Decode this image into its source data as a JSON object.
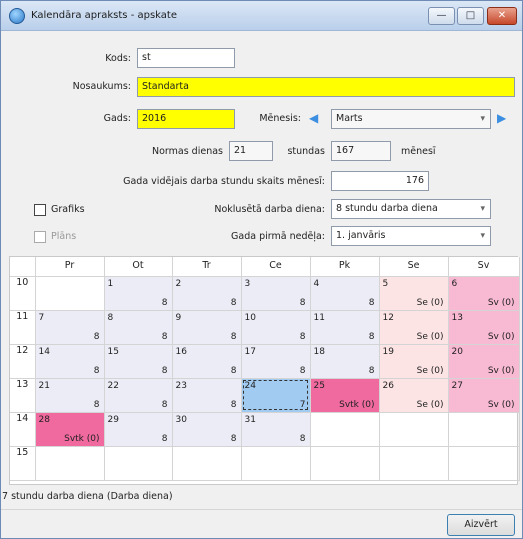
{
  "window": {
    "title": "Kalendāra apraksts - apskate",
    "btn_min": "—",
    "btn_max": "□",
    "btn_close": "✕"
  },
  "form": {
    "kods_label": "Kods:",
    "kods_value": "st",
    "nosaukums_label": "Nosaukums:",
    "nosaukums_value": "Standarta",
    "gads_label": "Gads:",
    "gads_value": "2016",
    "menesis_label": "Mēnesis:",
    "menesis_value": "Marts",
    "normas_label": "Normas dienas",
    "normas_value": "21",
    "stundas_label": "stundas",
    "stundas_value": "167",
    "menesi_label": "mēnesī",
    "vid_label": "Gada vidējais darba stundu skaits mēnesī:",
    "vid_value": "176",
    "grafiks_label": "Grafiks",
    "noklus_label": "Noklusētā darba diena:",
    "noklus_value": "8 stundu darba diena",
    "plans_label": "Plāns",
    "pirma_label": "Gada pirmā nedēļa:",
    "pirma_value": "1. janvāris"
  },
  "calendar": {
    "headers": [
      "Pr",
      "Ot",
      "Tr",
      "Ce",
      "Pk",
      "Se",
      "Sv"
    ],
    "weeks": [
      {
        "num": "10",
        "days": [
          {
            "type": "empty",
            "day": "",
            "hrs": ""
          },
          {
            "type": "wd",
            "day": "1",
            "hrs": "8"
          },
          {
            "type": "wd",
            "day": "2",
            "hrs": "8"
          },
          {
            "type": "wd",
            "day": "3",
            "hrs": "8"
          },
          {
            "type": "wd",
            "day": "4",
            "hrs": "8"
          },
          {
            "type": "sat",
            "day": "5",
            "hrs": "Se (0)"
          },
          {
            "type": "sun",
            "day": "6",
            "hrs": "Sv (0)"
          }
        ]
      },
      {
        "num": "11",
        "days": [
          {
            "type": "wd",
            "day": "7",
            "hrs": "8"
          },
          {
            "type": "wd",
            "day": "8",
            "hrs": "8"
          },
          {
            "type": "wd",
            "day": "9",
            "hrs": "8"
          },
          {
            "type": "wd",
            "day": "10",
            "hrs": "8"
          },
          {
            "type": "wd",
            "day": "11",
            "hrs": "8"
          },
          {
            "type": "sat",
            "day": "12",
            "hrs": "Se (0)"
          },
          {
            "type": "sun",
            "day": "13",
            "hrs": "Sv (0)"
          }
        ]
      },
      {
        "num": "12",
        "days": [
          {
            "type": "wd",
            "day": "14",
            "hrs": "8"
          },
          {
            "type": "wd",
            "day": "15",
            "hrs": "8"
          },
          {
            "type": "wd",
            "day": "16",
            "hrs": "8"
          },
          {
            "type": "wd",
            "day": "17",
            "hrs": "8"
          },
          {
            "type": "wd",
            "day": "18",
            "hrs": "8"
          },
          {
            "type": "sat",
            "day": "19",
            "hrs": "Se (0)"
          },
          {
            "type": "sun",
            "day": "20",
            "hrs": "Sv (0)"
          }
        ]
      },
      {
        "num": "13",
        "days": [
          {
            "type": "wd",
            "day": "21",
            "hrs": "8"
          },
          {
            "type": "wd",
            "day": "22",
            "hrs": "8"
          },
          {
            "type": "wd",
            "day": "23",
            "hrs": "8"
          },
          {
            "type": "sel",
            "day": "24",
            "hrs": "7"
          },
          {
            "type": "hol",
            "day": "25",
            "hrs": "Svtk (0)"
          },
          {
            "type": "sat",
            "day": "26",
            "hrs": "Se (0)"
          },
          {
            "type": "sun",
            "day": "27",
            "hrs": "Sv (0)"
          }
        ]
      },
      {
        "num": "14",
        "days": [
          {
            "type": "hol",
            "day": "28",
            "hrs": "Svtk (0)"
          },
          {
            "type": "wd",
            "day": "29",
            "hrs": "8"
          },
          {
            "type": "wd",
            "day": "30",
            "hrs": "8"
          },
          {
            "type": "wd",
            "day": "31",
            "hrs": "8"
          },
          {
            "type": "empty",
            "day": "",
            "hrs": ""
          },
          {
            "type": "empty",
            "day": "",
            "hrs": ""
          },
          {
            "type": "empty",
            "day": "",
            "hrs": ""
          }
        ]
      },
      {
        "num": "15",
        "days": [
          {
            "type": "empty",
            "day": "",
            "hrs": ""
          },
          {
            "type": "empty",
            "day": "",
            "hrs": ""
          },
          {
            "type": "empty",
            "day": "",
            "hrs": ""
          },
          {
            "type": "empty",
            "day": "",
            "hrs": ""
          },
          {
            "type": "empty",
            "day": "",
            "hrs": ""
          },
          {
            "type": "empty",
            "day": "",
            "hrs": ""
          },
          {
            "type": "empty",
            "day": "",
            "hrs": ""
          }
        ]
      }
    ]
  },
  "status": {
    "text": "7 stundu darba diena (Darba diena)"
  },
  "buttons": {
    "close": "Aizvērt"
  }
}
